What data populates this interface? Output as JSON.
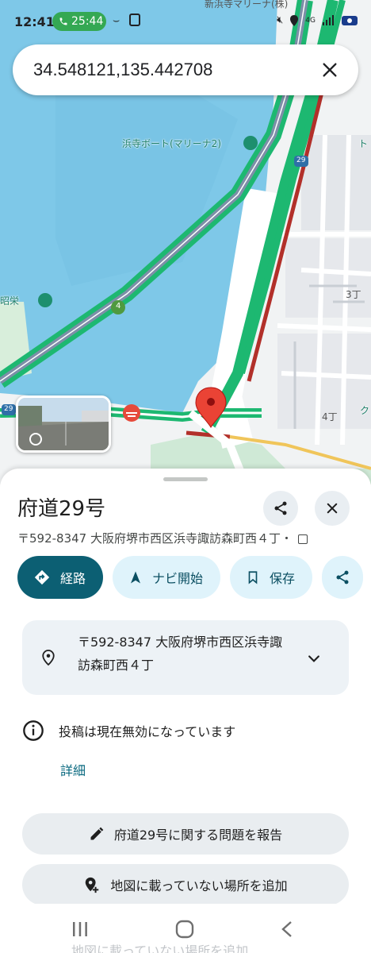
{
  "status_bar": {
    "time": "12:41",
    "call_duration": "25:44",
    "network": "4G",
    "icons": [
      "phone-icon",
      "mute-icon",
      "location-icon",
      "wifi-icon",
      "signal-icon",
      "battery-icon"
    ]
  },
  "search": {
    "query": "34.548121,135.442708",
    "clear_icon": "close-icon"
  },
  "map": {
    "labels": {
      "marina_top": "新浜寺マリーナ(株)",
      "marina": "浜寺ボート(マリーナ2)",
      "shouei": "昭栄",
      "block_3": "3丁",
      "block_4": "4丁",
      "route_29": "29",
      "route_4": "4",
      "route_29_left": "29",
      "edge_to": "ト",
      "edge_ku": "ク"
    },
    "colors": {
      "water": "#7ec8e8",
      "land": "#f1f3f4",
      "route_green": "#1db871",
      "traffic_red": "#c1372d",
      "pin_red": "#ea4335"
    }
  },
  "sheet": {
    "title": "府道29号",
    "subtitle": "〒592-8347 大阪府堺市西区浜寺諏訪森町西４丁・",
    "actions": [
      {
        "label": "経路",
        "icon": "directions-icon"
      },
      {
        "label": "ナビ開始",
        "icon": "navigation-icon"
      },
      {
        "label": "保存",
        "icon": "bookmark-icon"
      },
      {
        "label": "",
        "icon": "share-icon"
      }
    ],
    "address": "〒592-8347 大阪府堺市西区浜寺諏訪森町西４丁",
    "info_text": "投稿は現在無効になっています",
    "details_link": "詳細",
    "report_button": "府道29号に関する問題を報告",
    "add_place_button": "地図に載っていない場所を追加",
    "ghost_text": "地図に載っていない場所を追加",
    "accent": "#0c5f73"
  }
}
